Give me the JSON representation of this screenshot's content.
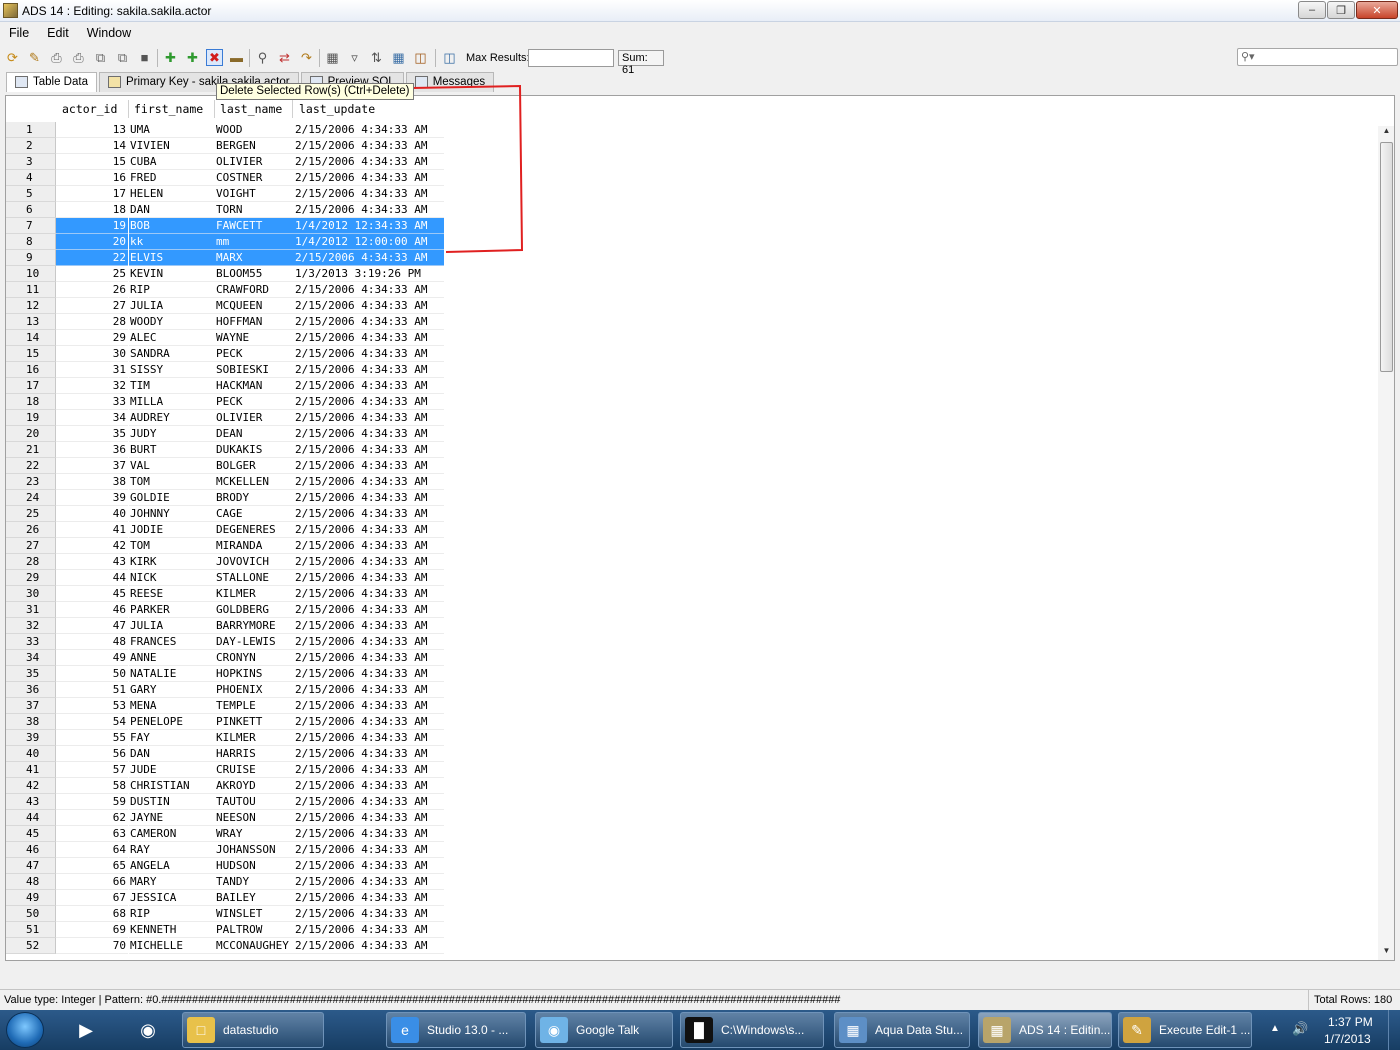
{
  "window": {
    "title": "ADS 14 : Editing: sakila.sakila.actor"
  },
  "menu": [
    "File",
    "Edit",
    "Window"
  ],
  "toolbar": {
    "icons": [
      "refresh-icon",
      "edit-icon",
      "print-icon",
      "print-preview-icon",
      "copy-icon",
      "paste-icon",
      "stop-icon",
      "insert-row-icon",
      "duplicate-row-icon",
      "delete-row-icon",
      "clear-icon",
      "find-icon",
      "replace-icon",
      "export-icon",
      "grid-icon",
      "filter-icon",
      "sort-icon",
      "calculator-icon",
      "layout-icon",
      "save-icon"
    ],
    "max_results_label": "Max Results:",
    "max_results_value": "",
    "sum_label": "Sum: 61",
    "search_placeholder": ""
  },
  "tabs": [
    {
      "label": "Table Data"
    },
    {
      "label": "Primary Key - sakila.sakila.actor"
    },
    {
      "label": "Preview SQL"
    },
    {
      "label": "Messages"
    }
  ],
  "tooltip": "Delete Selected Row(s) (Ctrl+Delete)",
  "grid": {
    "columns": [
      "actor_id",
      "first_name",
      "last_name",
      "last_update"
    ],
    "rows": [
      {
        "n": "1",
        "id": "13",
        "fn": "UMA",
        "ln": "WOOD",
        "lu": "2/15/2006 4:34:33 AM"
      },
      {
        "n": "2",
        "id": "14",
        "fn": "VIVIEN",
        "ln": "BERGEN",
        "lu": "2/15/2006 4:34:33 AM"
      },
      {
        "n": "3",
        "id": "15",
        "fn": "CUBA",
        "ln": "OLIVIER",
        "lu": "2/15/2006 4:34:33 AM"
      },
      {
        "n": "4",
        "id": "16",
        "fn": "FRED",
        "ln": "COSTNER",
        "lu": "2/15/2006 4:34:33 AM"
      },
      {
        "n": "5",
        "id": "17",
        "fn": "HELEN",
        "ln": "VOIGHT",
        "lu": "2/15/2006 4:34:33 AM"
      },
      {
        "n": "6",
        "id": "18",
        "fn": "DAN",
        "ln": "TORN",
        "lu": "2/15/2006 4:34:33 AM"
      },
      {
        "n": "7",
        "id": "19",
        "fn": "BOB",
        "ln": "FAWCETT",
        "lu": "1/4/2012 12:34:33 AM",
        "sel": true
      },
      {
        "n": "8",
        "id": "20",
        "fn": "kk",
        "ln": "mm",
        "lu": "1/4/2012 12:00:00 AM",
        "sel": true
      },
      {
        "n": "9",
        "id": "22",
        "fn": "ELVIS",
        "ln": "MARX",
        "lu": "2/15/2006 4:34:33 AM",
        "sel": true
      },
      {
        "n": "10",
        "id": "25",
        "fn": "KEVIN",
        "ln": "BLOOM55",
        "lu": "1/3/2013 3:19:26 PM"
      },
      {
        "n": "11",
        "id": "26",
        "fn": "RIP",
        "ln": "CRAWFORD",
        "lu": "2/15/2006 4:34:33 AM"
      },
      {
        "n": "12",
        "id": "27",
        "fn": "JULIA",
        "ln": "MCQUEEN",
        "lu": "2/15/2006 4:34:33 AM"
      },
      {
        "n": "13",
        "id": "28",
        "fn": "WOODY",
        "ln": "HOFFMAN",
        "lu": "2/15/2006 4:34:33 AM"
      },
      {
        "n": "14",
        "id": "29",
        "fn": "ALEC",
        "ln": "WAYNE",
        "lu": "2/15/2006 4:34:33 AM"
      },
      {
        "n": "15",
        "id": "30",
        "fn": "SANDRA",
        "ln": "PECK",
        "lu": "2/15/2006 4:34:33 AM"
      },
      {
        "n": "16",
        "id": "31",
        "fn": "SISSY",
        "ln": "SOBIESKI",
        "lu": "2/15/2006 4:34:33 AM"
      },
      {
        "n": "17",
        "id": "32",
        "fn": "TIM",
        "ln": "HACKMAN",
        "lu": "2/15/2006 4:34:33 AM"
      },
      {
        "n": "18",
        "id": "33",
        "fn": "MILLA",
        "ln": "PECK",
        "lu": "2/15/2006 4:34:33 AM"
      },
      {
        "n": "19",
        "id": "34",
        "fn": "AUDREY",
        "ln": "OLIVIER",
        "lu": "2/15/2006 4:34:33 AM"
      },
      {
        "n": "20",
        "id": "35",
        "fn": "JUDY",
        "ln": "DEAN",
        "lu": "2/15/2006 4:34:33 AM"
      },
      {
        "n": "21",
        "id": "36",
        "fn": "BURT",
        "ln": "DUKAKIS",
        "lu": "2/15/2006 4:34:33 AM"
      },
      {
        "n": "22",
        "id": "37",
        "fn": "VAL",
        "ln": "BOLGER",
        "lu": "2/15/2006 4:34:33 AM"
      },
      {
        "n": "23",
        "id": "38",
        "fn": "TOM",
        "ln": "MCKELLEN",
        "lu": "2/15/2006 4:34:33 AM"
      },
      {
        "n": "24",
        "id": "39",
        "fn": "GOLDIE",
        "ln": "BRODY",
        "lu": "2/15/2006 4:34:33 AM"
      },
      {
        "n": "25",
        "id": "40",
        "fn": "JOHNNY",
        "ln": "CAGE",
        "lu": "2/15/2006 4:34:33 AM"
      },
      {
        "n": "26",
        "id": "41",
        "fn": "JODIE",
        "ln": "DEGENERES",
        "lu": "2/15/2006 4:34:33 AM"
      },
      {
        "n": "27",
        "id": "42",
        "fn": "TOM",
        "ln": "MIRANDA",
        "lu": "2/15/2006 4:34:33 AM"
      },
      {
        "n": "28",
        "id": "43",
        "fn": "KIRK",
        "ln": "JOVOVICH",
        "lu": "2/15/2006 4:34:33 AM"
      },
      {
        "n": "29",
        "id": "44",
        "fn": "NICK",
        "ln": "STALLONE",
        "lu": "2/15/2006 4:34:33 AM"
      },
      {
        "n": "30",
        "id": "45",
        "fn": "REESE",
        "ln": "KILMER",
        "lu": "2/15/2006 4:34:33 AM"
      },
      {
        "n": "31",
        "id": "46",
        "fn": "PARKER",
        "ln": "GOLDBERG",
        "lu": "2/15/2006 4:34:33 AM"
      },
      {
        "n": "32",
        "id": "47",
        "fn": "JULIA",
        "ln": "BARRYMORE",
        "lu": "2/15/2006 4:34:33 AM"
      },
      {
        "n": "33",
        "id": "48",
        "fn": "FRANCES",
        "ln": "DAY-LEWIS",
        "lu": "2/15/2006 4:34:33 AM"
      },
      {
        "n": "34",
        "id": "49",
        "fn": "ANNE",
        "ln": "CRONYN",
        "lu": "2/15/2006 4:34:33 AM"
      },
      {
        "n": "35",
        "id": "50",
        "fn": "NATALIE",
        "ln": "HOPKINS",
        "lu": "2/15/2006 4:34:33 AM"
      },
      {
        "n": "36",
        "id": "51",
        "fn": "GARY",
        "ln": "PHOENIX",
        "lu": "2/15/2006 4:34:33 AM"
      },
      {
        "n": "37",
        "id": "53",
        "fn": "MENA",
        "ln": "TEMPLE",
        "lu": "2/15/2006 4:34:33 AM"
      },
      {
        "n": "38",
        "id": "54",
        "fn": "PENELOPE",
        "ln": "PINKETT",
        "lu": "2/15/2006 4:34:33 AM"
      },
      {
        "n": "39",
        "id": "55",
        "fn": "FAY",
        "ln": "KILMER",
        "lu": "2/15/2006 4:34:33 AM"
      },
      {
        "n": "40",
        "id": "56",
        "fn": "DAN",
        "ln": "HARRIS",
        "lu": "2/15/2006 4:34:33 AM"
      },
      {
        "n": "41",
        "id": "57",
        "fn": "JUDE",
        "ln": "CRUISE",
        "lu": "2/15/2006 4:34:33 AM"
      },
      {
        "n": "42",
        "id": "58",
        "fn": "CHRISTIAN",
        "ln": "AKROYD",
        "lu": "2/15/2006 4:34:33 AM"
      },
      {
        "n": "43",
        "id": "59",
        "fn": "DUSTIN",
        "ln": "TAUTOU",
        "lu": "2/15/2006 4:34:33 AM"
      },
      {
        "n": "44",
        "id": "62",
        "fn": "JAYNE",
        "ln": "NEESON",
        "lu": "2/15/2006 4:34:33 AM"
      },
      {
        "n": "45",
        "id": "63",
        "fn": "CAMERON",
        "ln": "WRAY",
        "lu": "2/15/2006 4:34:33 AM"
      },
      {
        "n": "46",
        "id": "64",
        "fn": "RAY",
        "ln": "JOHANSSON",
        "lu": "2/15/2006 4:34:33 AM"
      },
      {
        "n": "47",
        "id": "65",
        "fn": "ANGELA",
        "ln": "HUDSON",
        "lu": "2/15/2006 4:34:33 AM"
      },
      {
        "n": "48",
        "id": "66",
        "fn": "MARY",
        "ln": "TANDY",
        "lu": "2/15/2006 4:34:33 AM"
      },
      {
        "n": "49",
        "id": "67",
        "fn": "JESSICA",
        "ln": "BAILEY",
        "lu": "2/15/2006 4:34:33 AM"
      },
      {
        "n": "50",
        "id": "68",
        "fn": "RIP",
        "ln": "WINSLET",
        "lu": "2/15/2006 4:34:33 AM"
      },
      {
        "n": "51",
        "id": "69",
        "fn": "KENNETH",
        "ln": "PALTROW",
        "lu": "2/15/2006 4:34:33 AM"
      },
      {
        "n": "52",
        "id": "70",
        "fn": "MICHELLE",
        "ln": "MCCONAUGHEY",
        "lu": "2/15/2006 4:34:33 AM"
      }
    ]
  },
  "status": {
    "left": "Value type: Integer | Pattern: #0.###############################################################################################################",
    "right": "Total Rows: 180"
  },
  "taskbar": {
    "tasks": [
      {
        "label": "datastudio",
        "icon": "folder-icon"
      },
      {
        "label": "Studio 13.0 - ...",
        "icon": "ie-icon"
      },
      {
        "label": "Google Talk",
        "icon": "gtalk-icon"
      },
      {
        "label": "C:\\Windows\\s...",
        "icon": "cmd-icon"
      },
      {
        "label": "Aqua Data Stu...",
        "icon": "ads-icon"
      },
      {
        "label": "ADS 14 : Editin...",
        "icon": "ads14-icon",
        "active": true
      },
      {
        "label": "Execute Edit-1 ...",
        "icon": "paint-icon"
      }
    ],
    "time": "1:37 PM",
    "date": "1/7/2013"
  },
  "colors": {
    "selection": "#3399ff",
    "annotation": "#e02020",
    "tooltip_bg": "#ffffe1"
  }
}
